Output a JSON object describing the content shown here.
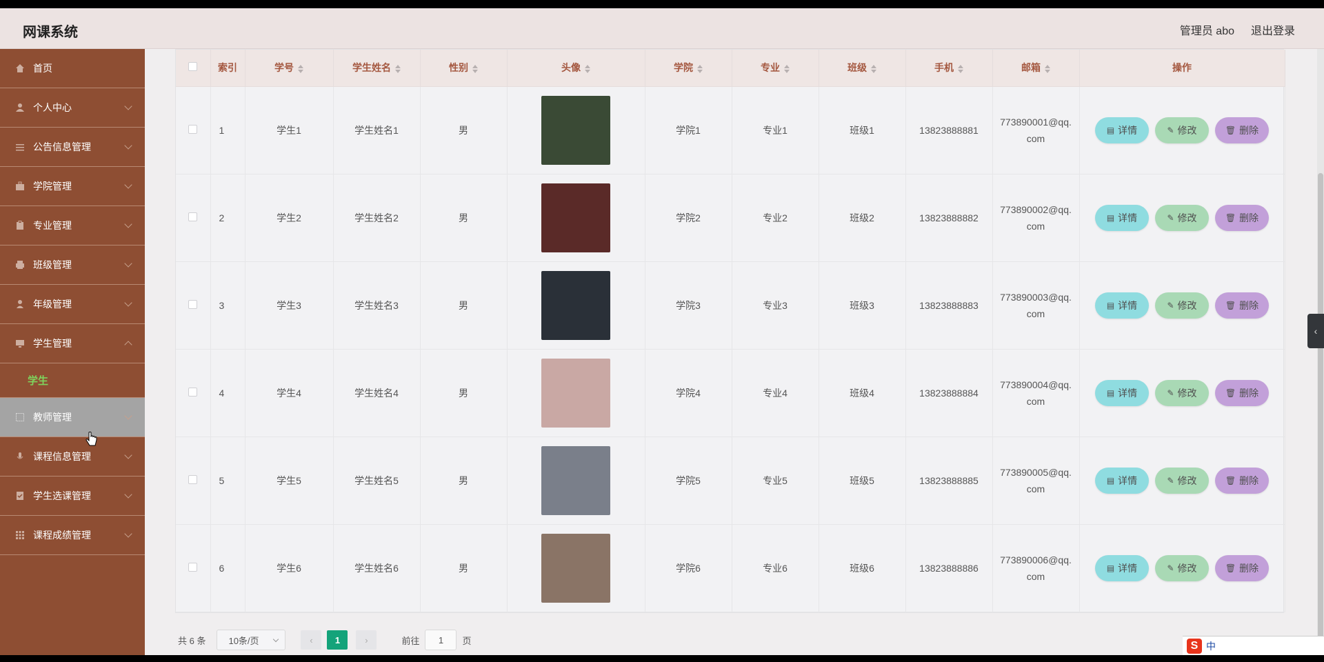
{
  "header": {
    "app_title": "网课系统",
    "admin_label": "管理员 abo",
    "logout_label": "退出登录"
  },
  "sidebar": {
    "items": [
      {
        "label": "首页",
        "icon": "home-icon"
      },
      {
        "label": "个人中心",
        "icon": "user-icon"
      },
      {
        "label": "公告信息管理",
        "icon": "sliders-icon"
      },
      {
        "label": "学院管理",
        "icon": "briefcase-icon"
      },
      {
        "label": "专业管理",
        "icon": "clipboard-icon"
      },
      {
        "label": "班级管理",
        "icon": "printer-icon"
      },
      {
        "label": "年级管理",
        "icon": "person-icon"
      },
      {
        "label": "学生管理",
        "icon": "monitor-icon"
      },
      {
        "label": "教师管理",
        "icon": "frame-icon"
      },
      {
        "label": "课程信息管理",
        "icon": "mic-icon"
      },
      {
        "label": "学生选课管理",
        "icon": "check-list-icon"
      },
      {
        "label": "课程成绩管理",
        "icon": "grid-icon"
      }
    ],
    "submenu_student": "学生"
  },
  "table": {
    "columns": [
      "索引",
      "学号",
      "学生姓名",
      "性别",
      "头像",
      "学院",
      "专业",
      "班级",
      "手机",
      "邮箱",
      "操作"
    ],
    "rows": [
      {
        "index": "1",
        "id": "学生1",
        "name": "学生姓名1",
        "gender": "男",
        "college": "学院1",
        "major": "专业1",
        "class": "班级1",
        "phone": "13823888881",
        "email": "773890001@qq.com",
        "avatar_color": "#3a4a35"
      },
      {
        "index": "2",
        "id": "学生2",
        "name": "学生姓名2",
        "gender": "男",
        "college": "学院2",
        "major": "专业2",
        "class": "班级2",
        "phone": "13823888882",
        "email": "773890002@qq.com",
        "avatar_color": "#5a2a28"
      },
      {
        "index": "3",
        "id": "学生3",
        "name": "学生姓名3",
        "gender": "男",
        "college": "学院3",
        "major": "专业3",
        "class": "班级3",
        "phone": "13823888883",
        "email": "773890003@qq.com",
        "avatar_color": "#2a3038"
      },
      {
        "index": "4",
        "id": "学生4",
        "name": "学生姓名4",
        "gender": "男",
        "college": "学院4",
        "major": "专业4",
        "class": "班级4",
        "phone": "13823888884",
        "email": "773890004@qq.com",
        "avatar_color": "#c9a8a4"
      },
      {
        "index": "5",
        "id": "学生5",
        "name": "学生姓名5",
        "gender": "男",
        "college": "学院5",
        "major": "专业5",
        "class": "班级5",
        "phone": "13823888885",
        "email": "773890005@qq.com",
        "avatar_color": "#7a7f8a"
      },
      {
        "index": "6",
        "id": "学生6",
        "name": "学生姓名6",
        "gender": "男",
        "college": "学院6",
        "major": "专业6",
        "class": "班级6",
        "phone": "13823888886",
        "email": "773890006@qq.com",
        "avatar_color": "#8a7466"
      }
    ],
    "actions": {
      "detail": "详情",
      "edit": "修改",
      "delete": "删除"
    }
  },
  "pager": {
    "total": "共 6 条",
    "page_size": "10条/页",
    "current_page": "1",
    "goto_prefix": "前往",
    "goto_value": "1",
    "goto_suffix": "页"
  },
  "ime": {
    "label": "中"
  },
  "colors": {
    "sidebar": "#8e4e33",
    "accent": "#14a37a",
    "header_text": "#a4573f"
  }
}
